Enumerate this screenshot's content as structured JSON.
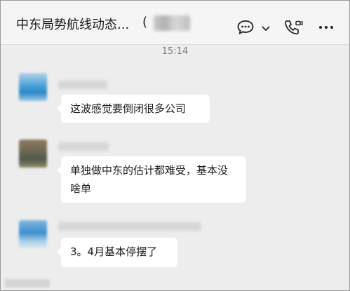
{
  "header": {
    "title": "中东局势航线动态...",
    "title_suffix": "(",
    "icons": [
      "chat-bubble-icon",
      "chevron-down-icon",
      "video-call-icon",
      "more-icon"
    ]
  },
  "timestamp": "15:14",
  "messages": [
    {
      "text": "这波感觉要倒闭很多公司"
    },
    {
      "text": "单独做中东的估计都难受，基本没啥单"
    },
    {
      "text": "3。4月基本停摆了"
    }
  ],
  "colors": {
    "chat_background": "#ededed",
    "header_background": "#f5f5f5",
    "bubble": "#ffffff"
  }
}
